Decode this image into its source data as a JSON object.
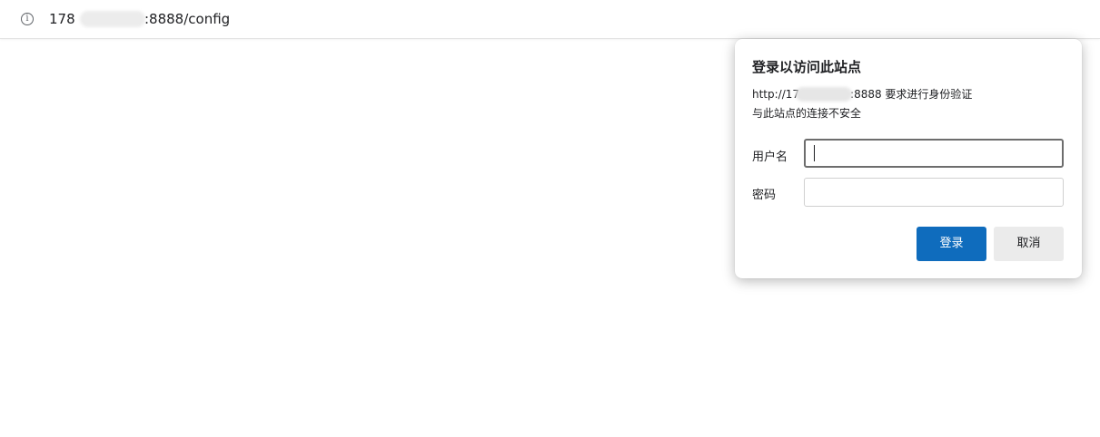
{
  "address_bar": {
    "info_icon": "info-circle-icon",
    "url_prefix": "178",
    "url_suffix": ":8888/config"
  },
  "dialog": {
    "title": "登录以访问此站点",
    "url_prefix": "http://17",
    "url_suffix": ":8888 要求进行身份验证",
    "warning": "与此站点的连接不安全",
    "username_label": "用户名",
    "username_value": "",
    "password_label": "密码",
    "password_value": "",
    "login_button": "登录",
    "cancel_button": "取消"
  },
  "colors": {
    "accent": "#0f6cbd",
    "cancel_bg": "#ebebeb"
  }
}
